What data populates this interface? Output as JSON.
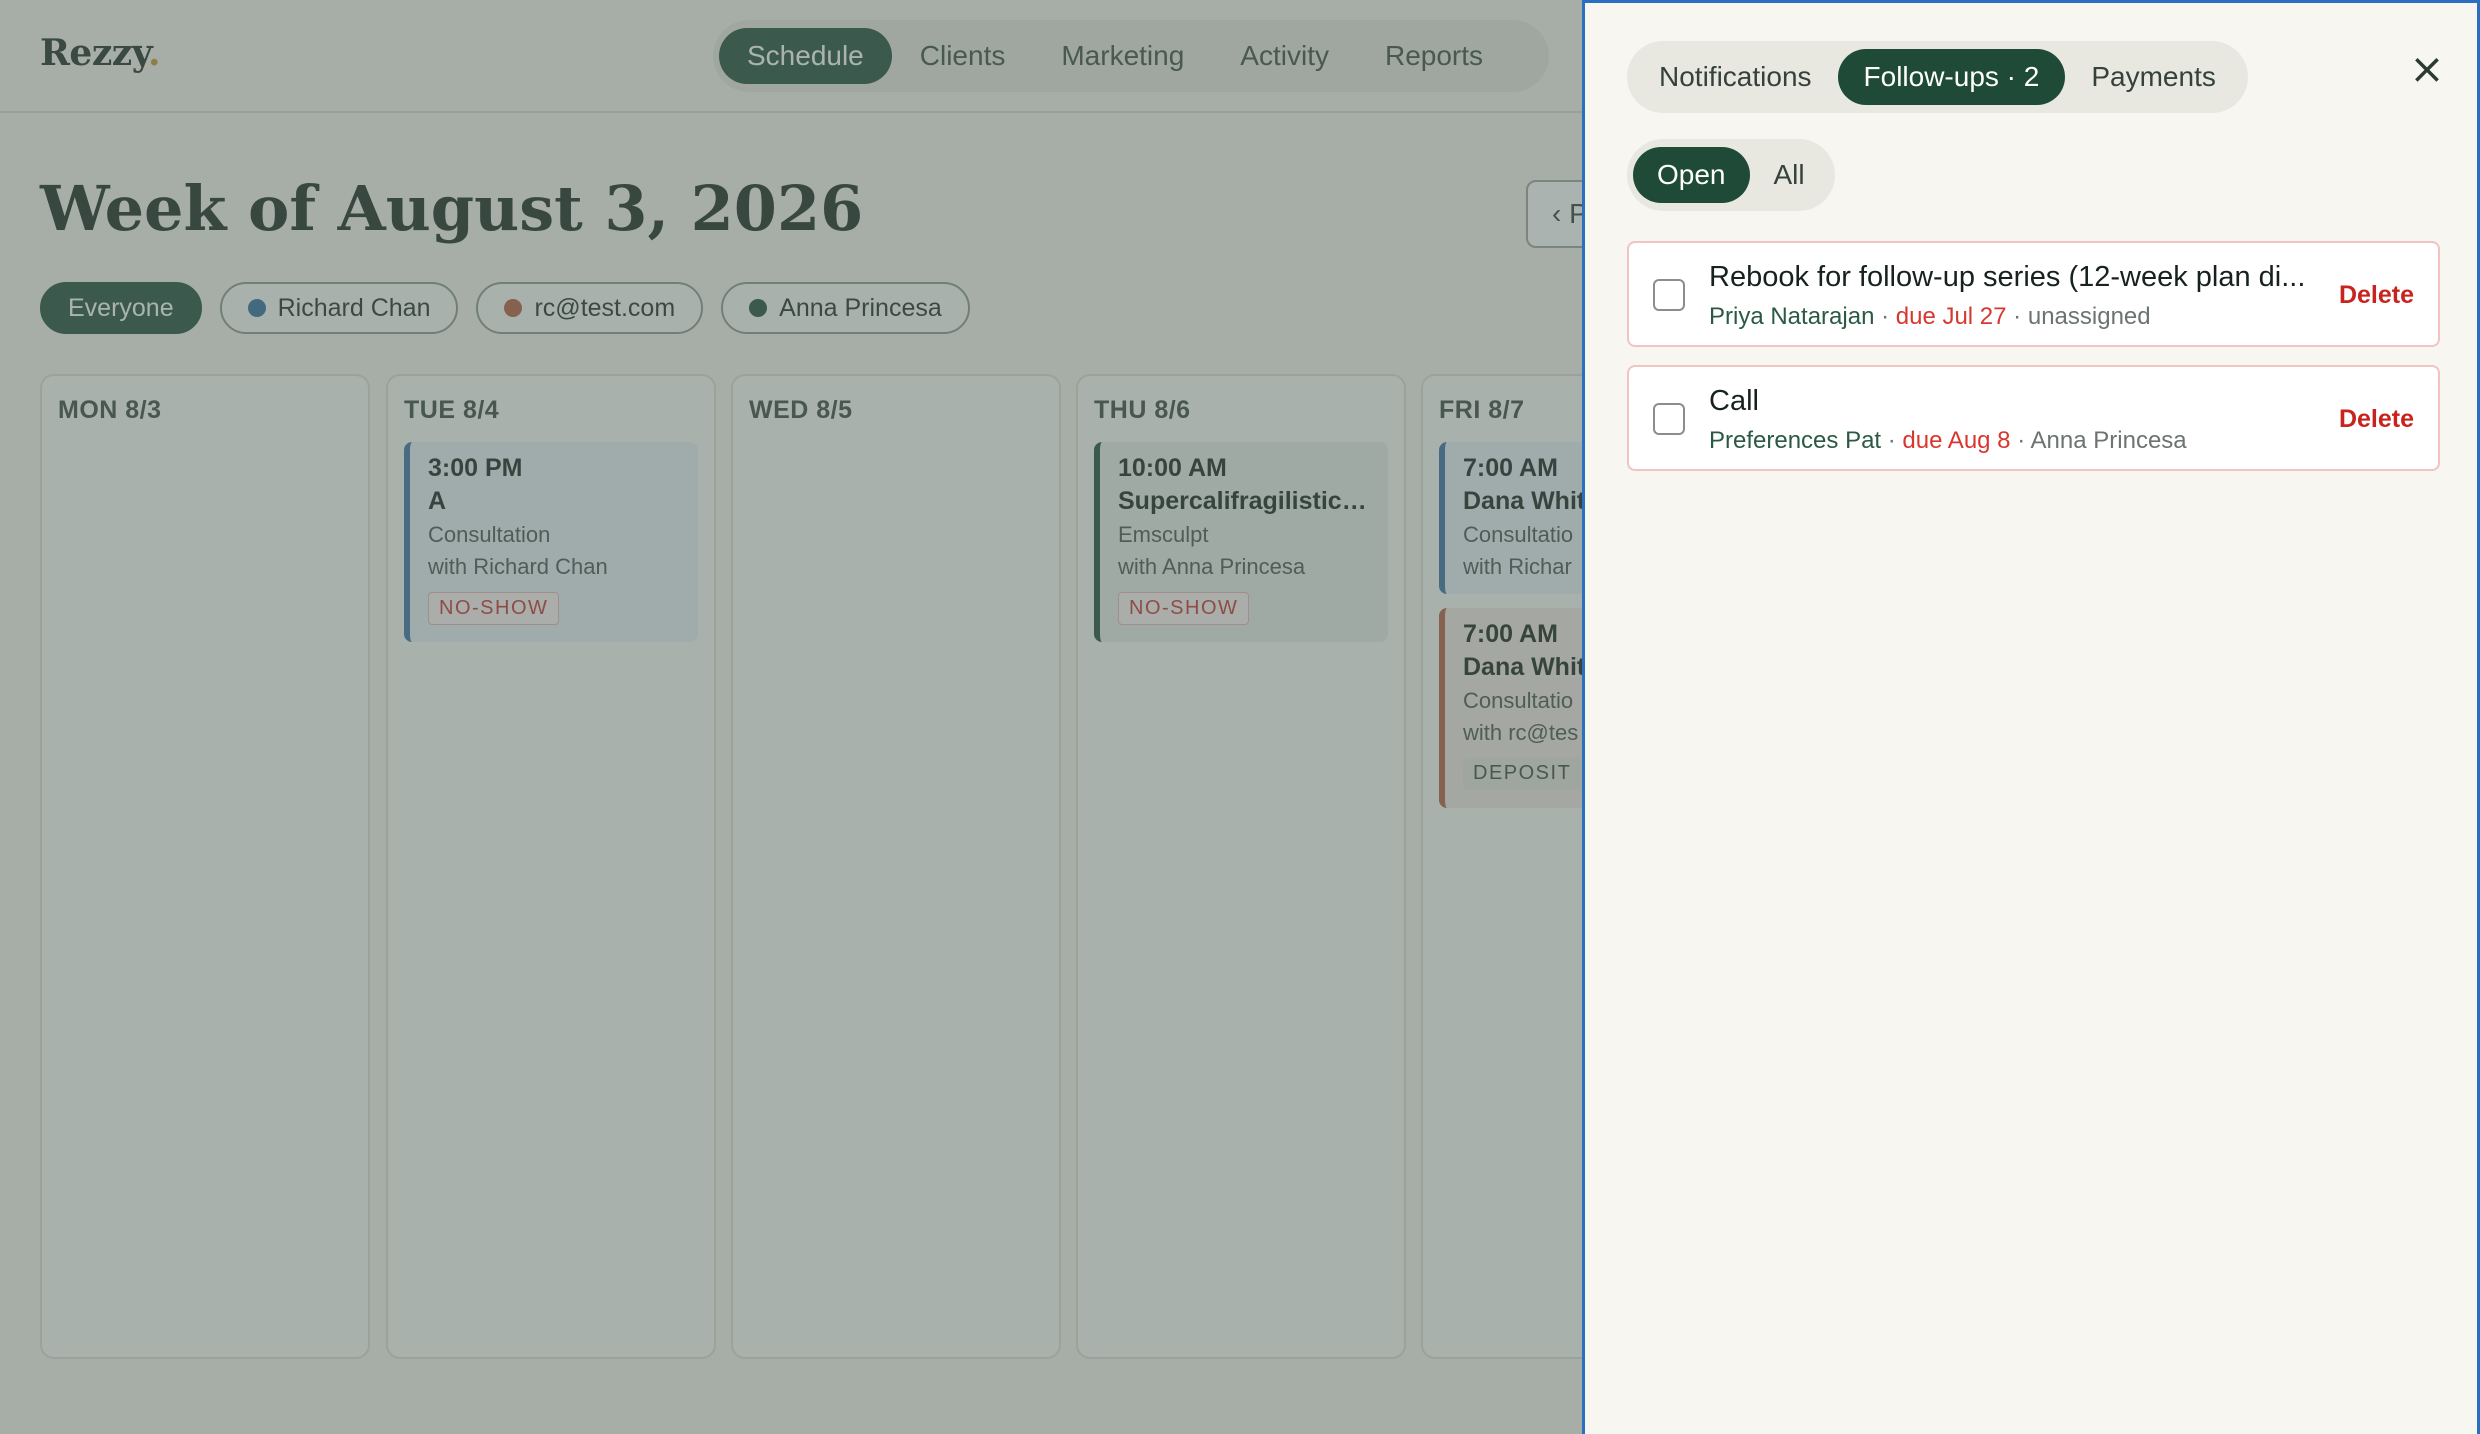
{
  "app": {
    "logo": "Rezzy",
    "logo_dot": ".",
    "nav": [
      "Schedule",
      "Clients",
      "Marketing",
      "Activity",
      "Reports"
    ],
    "nav_active": "Schedule"
  },
  "schedule": {
    "week_title": "Week of August 3, 2026",
    "prev_label": "‹ P",
    "filters": [
      {
        "label": "Everyone",
        "color": null
      },
      {
        "label": "Richard Chan",
        "color": "#2f6aa0"
      },
      {
        "label": "rc@test.com",
        "color": "#b55a3c"
      },
      {
        "label": "Anna Princesa",
        "color": "#1f4a37"
      }
    ],
    "days": [
      {
        "label": "MON 8/3"
      },
      {
        "label": "TUE 8/4"
      },
      {
        "label": "WED 8/5"
      },
      {
        "label": "THU 8/6"
      },
      {
        "label": "FRI 8/7"
      }
    ],
    "appointments": {
      "tue_1": {
        "time": "3:00 PM",
        "title": "A",
        "service": "Consultation",
        "with": "with Richard Chan",
        "badge": "NO-SHOW",
        "color": "#3a6ea3"
      },
      "thu_1": {
        "time": "10:00 AM",
        "title": "Supercalifragilistice...",
        "service": "Emsculpt",
        "with": "with Anna Princesa",
        "badge": "NO-SHOW",
        "color": "#1f4a37"
      },
      "fri_1": {
        "time": "7:00 AM",
        "title": "Dana Whit",
        "service": "Consultatio",
        "with": "with Richar",
        "color": "#3a6ea3"
      },
      "fri_2": {
        "time": "7:00 AM",
        "title": "Dana Whit",
        "service": "Consultatio",
        "with": "with rc@tes",
        "badge": "DEPOSIT",
        "color": "#b55a3c"
      }
    }
  },
  "drawer": {
    "tabs": [
      "Notifications",
      "Follow-ups · 2",
      "Payments"
    ],
    "active_tab": "Follow-ups · 2",
    "close_icon": "×",
    "status_tabs": [
      "Open",
      "All"
    ],
    "active_status": "Open",
    "followups": [
      {
        "title": "Rebook for follow-up series (12-week plan di...",
        "client": "Priya Natarajan",
        "sep1": " · ",
        "due": "due Jul 27",
        "sep2": " · ",
        "assignee": "unassigned",
        "delete": "Delete"
      },
      {
        "title": "Call",
        "client": "Preferences Pat",
        "sep1": " · ",
        "due": "due Aug 8",
        "sep2": " · ",
        "assignee": "Anna Princesa",
        "delete": "Delete"
      }
    ]
  }
}
